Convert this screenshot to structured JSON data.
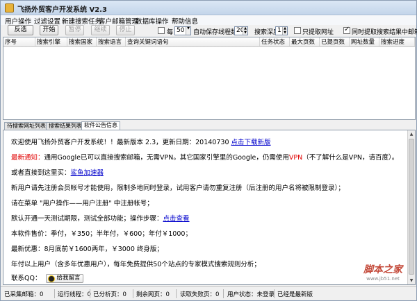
{
  "window": {
    "title": "飞扬外贸客户开发系统 V2.3"
  },
  "menu": [
    "用户操作",
    "过滤设置",
    "新建搜索任务",
    "客户邮箱管理",
    "数据库操作",
    "帮助信息"
  ],
  "toolbar": {
    "buttons": [
      {
        "label": "反选",
        "enabled": true
      },
      {
        "label": "开始",
        "enabled": true
      },
      {
        "label": "暂停",
        "enabled": false
      },
      {
        "label": "继续",
        "enabled": false
      },
      {
        "label": "停止",
        "enabled": false
      }
    ],
    "per_label": "每",
    "per_value": "50",
    "autosave_label": "自动保存",
    "threads_label": "线程数",
    "threads_value": "20",
    "depth_label": "搜索深度",
    "depth_value": "1",
    "only_url_label": "只提取网址",
    "only_url_checked": false,
    "simultaneous_label": "同时提取搜索结果中邮箱",
    "simultaneous_checked": true
  },
  "grid": {
    "columns": [
      "序号",
      "搜索引擎",
      "搜索国家",
      "搜索语言",
      "查询关键词语句",
      "任务状态",
      "最大页数",
      "已提页数",
      "网址数量",
      "搜索进度"
    ]
  },
  "tabs": [
    "待搜索网址列表",
    "搜索结果列表",
    "软件公告信息"
  ],
  "active_tab": 2,
  "notice": {
    "l1_text": "欢迎使用飞扬外贸客户开发系统！！最新版本 2.3，更新日期：20140730 ",
    "l1_link": "点击下载新版",
    "l2_red": "最新通知：",
    "l2_text1": "通用Google已可以直接搜索邮箱，无需VPN。其它国家引擎里的Google，仍需使用",
    "l2_red2": "VPN",
    "l2_text2": "（不了解什么是VPN，请百度）。",
    "l3_text": "或者直接到这里买：",
    "l3_link": "鲨鱼加速器",
    "l4_text": "新用户请先注册会员帐号才能使用，限制多地同时登录，试用客户请勿重复注册（后注册的用户名将被限制登录）；",
    "l5_text": "请在菜单 \"用户操作——用户注册\" 中注册帐号；",
    "l6_text": "默认开通一天测试期限，测试全部功能；操作步骤：",
    "l6_link": "点击查看",
    "l7_text": "本软件售价：季付，￥350；半年付，￥600；年付￥1000；",
    "l8_text": "最新优惠：8月底前￥1600两年，￥3000 终身版；",
    "l9_text": "年付以上用户（含多年优惠用户），每年免费提供50个站点的专家模式搜索规则分析；",
    "qq_label": "联系QQ：",
    "qq_button": "给我留言"
  },
  "watermark": {
    "big": "脚本之家",
    "small": "www.jb51.net"
  },
  "status": [
    "已采集邮箱：0",
    "运行线程：0",
    "已分析页：0",
    "剩余网页：0",
    "读取失败页：0",
    "用户状态：未登录",
    "已经是最新版"
  ]
}
